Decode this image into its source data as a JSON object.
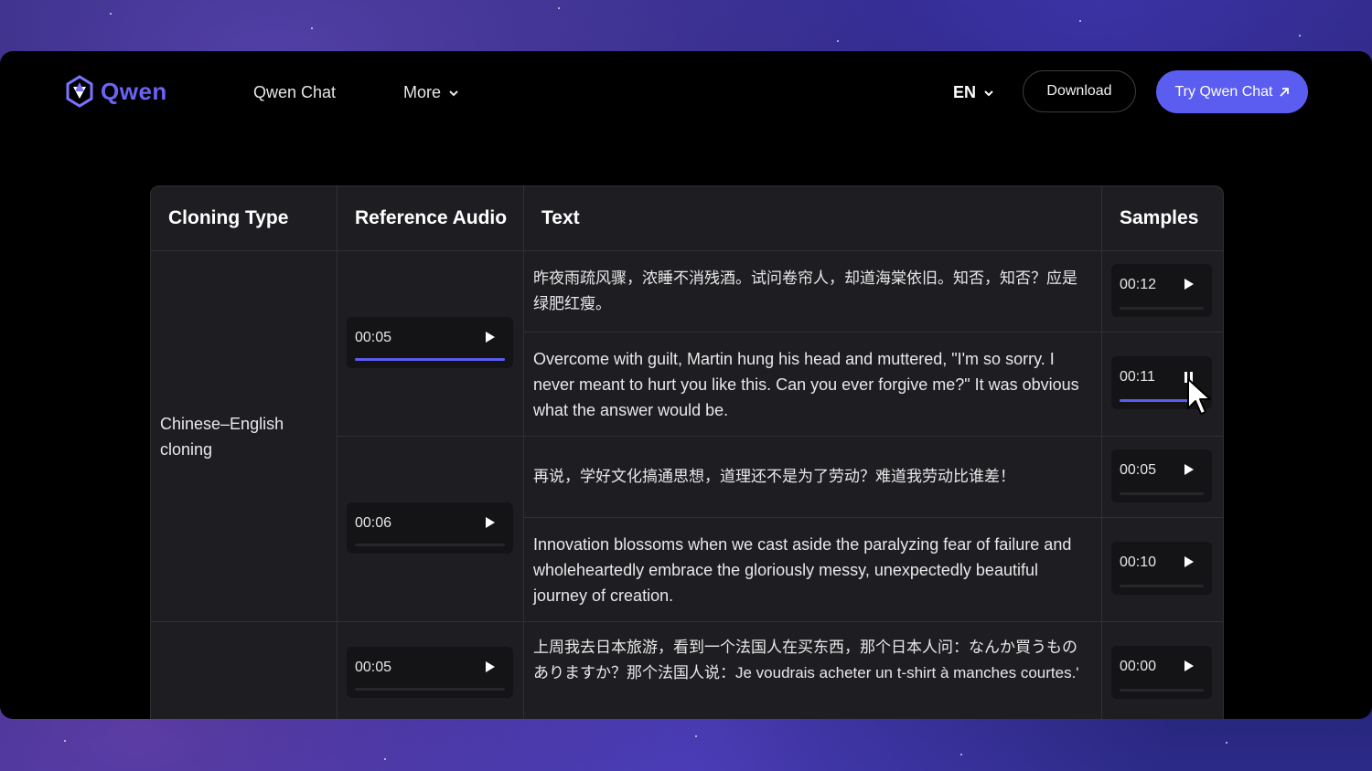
{
  "nav": {
    "logo_text": "Qwen",
    "links": [
      "Qwen Chat",
      "More"
    ],
    "lang": "EN",
    "download": "Download",
    "try": "Try Qwen Chat"
  },
  "table": {
    "headers": [
      "Cloning Type",
      "Reference Audio",
      "Text",
      "Samples"
    ],
    "cloning_type": "Chinese–English cloning",
    "reference_audio": [
      {
        "time": "00:05",
        "progress": 1.0
      },
      {
        "time": "00:06",
        "progress": 0
      },
      {
        "time": "00:05",
        "progress": 0
      }
    ],
    "rows": [
      {
        "text": "昨夜雨疏风骤，浓睡不消残酒。试问卷帘人，却道海棠依旧。知否，知否？应是绿肥红瘦。",
        "sample": "00:12",
        "progress": 0,
        "playing": false
      },
      {
        "text": "Overcome with guilt, Martin hung his head and muttered, \"I'm so sorry. I never meant to hurt you like this. Can you ever forgive me?\" It was obvious what the answer would be.",
        "sample": "00:11",
        "progress": 0.85,
        "playing": true
      },
      {
        "text": "再说，学好文化搞通思想，道理还不是为了劳动？难道我劳动比谁差！",
        "sample": "00:05",
        "progress": 0,
        "playing": false
      },
      {
        "text": "Innovation blossoms when we cast aside the paralyzing fear of failure and wholeheartedly embrace the gloriously messy, unexpectedly beautiful journey of creation.",
        "sample": "00:10",
        "progress": 0,
        "playing": false
      },
      {
        "text": "上周我去日本旅游，看到一个法国人在买东西，那个日本人问：なんか買うものありますか？那个法国人说：Je voudrais acheter un t-shirt à manches courtes.'",
        "sample": "00:00",
        "progress": 0,
        "playing": false
      }
    ]
  }
}
